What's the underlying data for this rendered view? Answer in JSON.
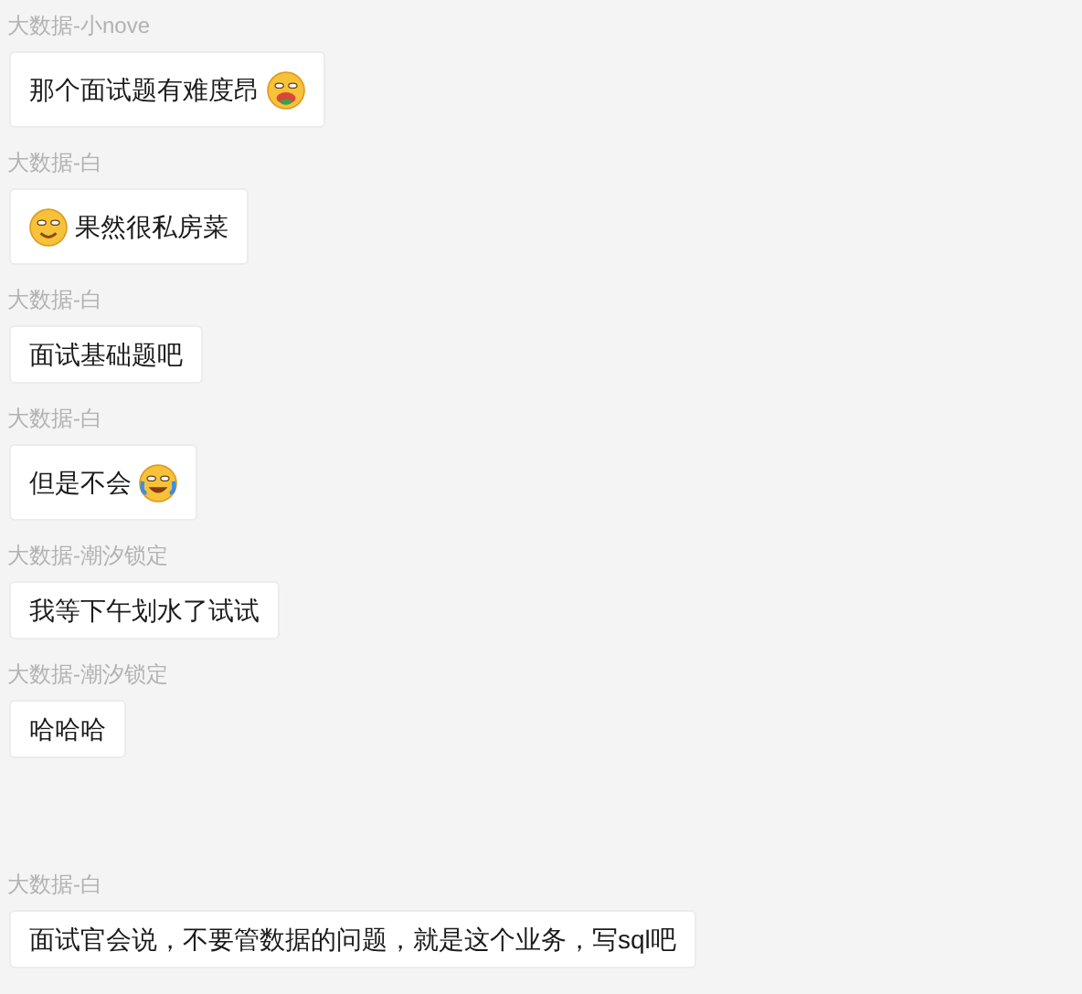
{
  "messages": [
    {
      "sender": "大数据-小nove",
      "parts": [
        {
          "kind": "text",
          "text": "那个面试题有难度昂"
        },
        {
          "kind": "drool"
        }
      ]
    },
    {
      "sender": "大数据-白",
      "parts": [
        {
          "kind": "smirk"
        },
        {
          "kind": "text",
          "text": "果然很私房菜"
        }
      ]
    },
    {
      "sender": "大数据-白",
      "parts": [
        {
          "kind": "text",
          "text": "面试基础题吧"
        }
      ]
    },
    {
      "sender": "大数据-白",
      "parts": [
        {
          "kind": "text",
          "text": "但是不会"
        },
        {
          "kind": "sob"
        }
      ]
    },
    {
      "sender": "大数据-潮汐锁定",
      "parts": [
        {
          "kind": "text",
          "text": "我等下午划水了试试"
        }
      ]
    },
    {
      "sender": "大数据-潮汐锁定",
      "parts": [
        {
          "kind": "text",
          "text": "哈哈哈"
        }
      ]
    },
    {
      "sender": "大数据-白",
      "parts": [
        {
          "kind": "text",
          "text": "面试官会说，不要管数据的问题，就是这个业务，写sql吧"
        }
      ]
    }
  ]
}
